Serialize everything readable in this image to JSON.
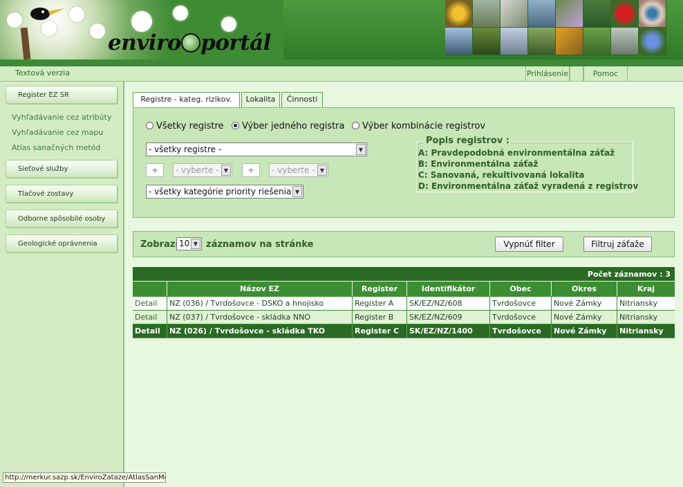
{
  "header": {
    "logo_prefix": "enviro",
    "logo_suffix": "portál"
  },
  "subnav": {
    "text_version": "Textová verzia",
    "login": "Prihlásenie",
    "help": "Pomoc"
  },
  "sidebar": {
    "register_ez": "Register EZ SR",
    "links": [
      "Vyhľadávanie cez atribúty",
      "Vyhľadávanie cez mapu",
      "Atlas sanačných metód"
    ],
    "buttons": [
      "Sieťové služby",
      "Tlačové zostavy",
      "Odborne spôsobilé osoby",
      "Geologické oprávnenia"
    ]
  },
  "tabs": [
    "Registre - kateg. rizikov.",
    "Lokalita",
    "Činnosti"
  ],
  "filter": {
    "radio_all": "Všetky registre",
    "radio_one": "Výber jedného registra",
    "radio_combo": "Výber kombinácie registrov",
    "register_select": "- všetky registre -",
    "plus": "+",
    "choose": "- vyberte -",
    "priority_select": "- všetky kategórie priority riešenia -"
  },
  "legend": {
    "title": "Popis registrov :",
    "items": [
      "A: Pravdepodobná environmentálna záťaž",
      "B: Environmentálna záťaž",
      "C: Sanovaná, rekultivovaná lokalita",
      "D: Environmentálna záťaž vyradená z registrov"
    ]
  },
  "pager": {
    "show_label": "Zobrazí",
    "per_page": "10",
    "records_label": "záznamov na stránke",
    "disable_filter": "Vypnúť filter",
    "filter_loads": "Filtruj záťaže"
  },
  "table": {
    "count_label": "Počet záznamov : 3",
    "headers": [
      "Názov EZ",
      "Register",
      "Identifikátor",
      "Obec",
      "Okres",
      "Kraj"
    ],
    "rows": [
      [
        "Detail",
        "NZ (036) / Tvrdošovce - DSKO a hnojisko",
        "Register A",
        "SK/EZ/NZ/608",
        "Tvrdošovce",
        "Nové Zámky",
        "Nitriansky"
      ],
      [
        "Detail",
        "NZ (037) / Tvrdošovce - skládka NNO",
        "Register B",
        "SK/EZ/NZ/609",
        "Tvrdošovce",
        "Nové Zámky",
        "Nitriansky"
      ],
      [
        "Detail",
        "NZ (026) / Tvrdošovce - skládka TKO",
        "Register C",
        "SK/EZ/NZ/1400",
        "Tvrdošovce",
        "Nové Zámky",
        "Nitriansky"
      ]
    ]
  },
  "status_bar": "http://merkur.sazp.sk/EnviroZataze/AtlasSanMe",
  "colors": {
    "header_green": "#3e8a36",
    "panel_green": "#c8e7b8",
    "selected_row": "#2b6a24"
  }
}
